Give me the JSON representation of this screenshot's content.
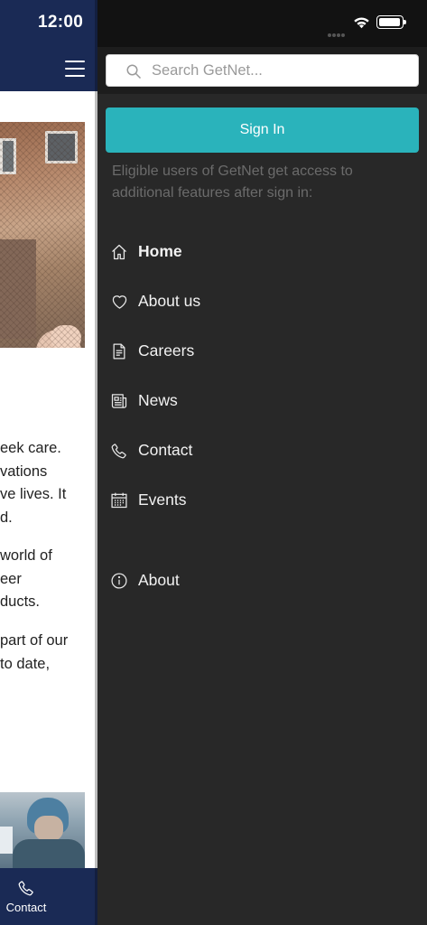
{
  "status_bar": {
    "time": "12:00"
  },
  "background_page": {
    "paragraphs": [
      [
        "eek care.",
        "vations",
        "ve lives. It",
        "d."
      ],
      [
        "world of",
        "eer",
        "ducts."
      ],
      [
        "part of our",
        "to date,"
      ]
    ],
    "bottom_nav": {
      "contact_label": "Contact"
    }
  },
  "drawer": {
    "search": {
      "placeholder": "Search GetNet..."
    },
    "sign_in": {
      "label": "Sign In",
      "hint": "Eligible users of GetNet get access to additional features after sign in:"
    },
    "items": [
      {
        "label": "Home",
        "icon": "home-icon",
        "active": true
      },
      {
        "label": "About us",
        "icon": "heart-icon"
      },
      {
        "label": "Careers",
        "icon": "document-icon"
      },
      {
        "label": "News",
        "icon": "newspaper-icon"
      },
      {
        "label": "Contact",
        "icon": "phone-icon"
      },
      {
        "label": "Events",
        "icon": "calendar-icon"
      }
    ],
    "footer_items": [
      {
        "label": "About",
        "icon": "info-icon"
      }
    ]
  },
  "colors": {
    "brand_navy": "#1a2a55",
    "accent_teal": "#2ab3bb",
    "drawer_bg": "#282828"
  }
}
